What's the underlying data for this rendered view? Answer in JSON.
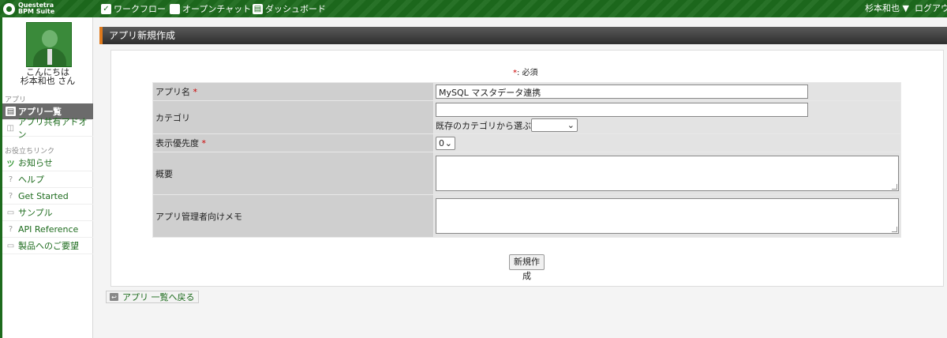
{
  "topbar": {
    "logo_line1": "Questetra",
    "logo_line2": "BPM Suite",
    "nav": {
      "workflow": "ワークフロー",
      "chat": "オープンチャット",
      "dashboard": "ダッシュボード"
    },
    "user": "杉本和也 ▼",
    "logout": "ログアウト"
  },
  "sidebar": {
    "greeting_line1": "こんにちは",
    "greeting_line2": "杉本和也 さん",
    "section_app": "アプリ",
    "app_items": [
      "アプリ一覧",
      "アプリ共有アドオン"
    ],
    "section_links": "お役立ちリンク",
    "link_items": [
      "お知らせ",
      "ヘルプ",
      "Get Started",
      "サンプル",
      "API Reference",
      "製品へのご要望"
    ]
  },
  "page": {
    "title": "アプリ新規作成",
    "required_note_star": "*",
    "required_note_text": ": 必須"
  },
  "form": {
    "app_name_label": "アプリ名",
    "app_name_value": "MySQL マスタデータ連携",
    "category_label": "カテゴリ",
    "category_value": "",
    "category_choose_label": "既存のカテゴリから選ぶ",
    "category_select_value": "",
    "priority_label": "表示優先度",
    "priority_value": "0",
    "summary_label": "概要",
    "admin_memo_label": "アプリ管理者向けメモ",
    "required_star": "*"
  },
  "buttons": {
    "create": "新規作成",
    "back": "アプリ 一覧へ戻る"
  },
  "colors": {
    "brand_green": "#1d6b1d",
    "header_accent": "#e07a1c",
    "required": "#cc0000"
  }
}
